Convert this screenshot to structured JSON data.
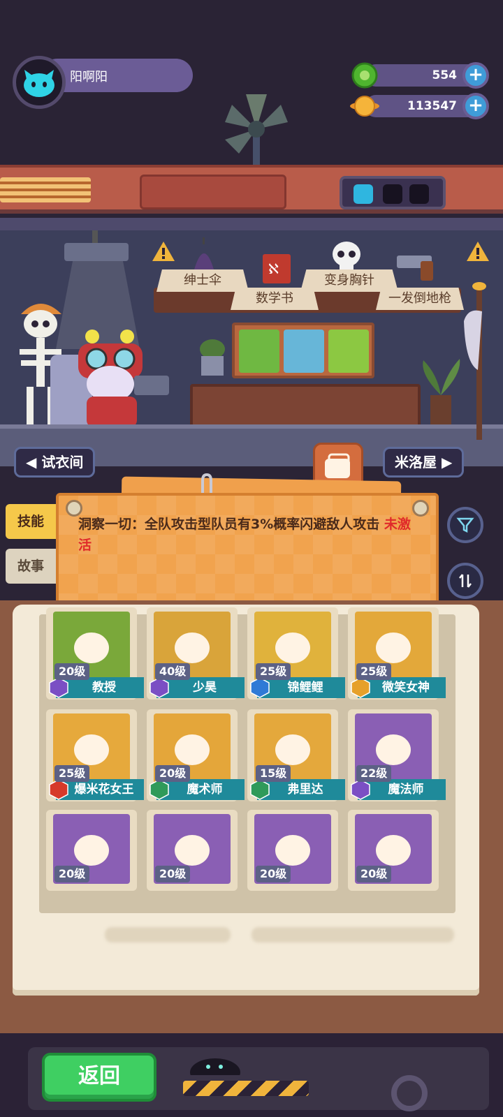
{
  "player": {
    "name": "阳啊阳",
    "avatar_icon": "cat-face-icon"
  },
  "currencies": [
    {
      "name": "gem",
      "value": "554",
      "icon": "green-gem-icon",
      "add_icon": "plus-icon"
    },
    {
      "name": "coin",
      "value": "113547",
      "icon": "orange-planet-coin-icon",
      "add_icon": "plus-icon"
    }
  ],
  "shelf_items": [
    {
      "label": "绅士伞",
      "icon": "umbrella-icon"
    },
    {
      "label": "数学书",
      "icon": "book-icon"
    },
    {
      "label": "变身胸针",
      "icon": "skull-icon"
    },
    {
      "label": "一发倒地枪",
      "icon": "pistol-icon"
    }
  ],
  "nav": {
    "left_label": "试衣间",
    "right_label": "米洛屋",
    "left_icon": "triangle-left-icon",
    "right_icon": "triangle-right-icon"
  },
  "side_tabs": {
    "skill": "技能",
    "story": "故事"
  },
  "skill": {
    "text": "洞察一切：全队攻击型队员有3%概率闪避敌人攻击",
    "status": "未激活",
    "status_color": "#e02a2a"
  },
  "round_buttons": {
    "filter_icon": "filter-icon",
    "sort_icon": "sort-arrows-icon"
  },
  "characters": [
    {
      "name": "教授",
      "level": "20级",
      "rank": "purple",
      "bg": "#7aa83a"
    },
    {
      "name": "少昊",
      "level": "40级",
      "rank": "purple",
      "bg": "#d9a43a"
    },
    {
      "name": "锦鲤鲤",
      "level": "25级",
      "rank": "blue",
      "bg": "#e0b23c"
    },
    {
      "name": "微笑女神",
      "level": "25级",
      "rank": "orange",
      "bg": "#e3a83a"
    },
    {
      "name": "爆米花女王",
      "level": "25级",
      "rank": "red",
      "bg": "#e6a93c"
    },
    {
      "name": "魔术师",
      "level": "20级",
      "rank": "green",
      "bg": "#e4a63a"
    },
    {
      "name": "弗里达",
      "level": "15级",
      "rank": "green",
      "bg": "#e4a83c"
    },
    {
      "name": "魔法师",
      "level": "22级",
      "rank": "purple",
      "bg": "#8a5fb4"
    },
    {
      "name": "",
      "level": "20级",
      "rank": "orange",
      "bg": "#8a5fb4"
    },
    {
      "name": "",
      "level": "20级",
      "rank": "orange",
      "bg": "#8a5fb4"
    },
    {
      "name": "",
      "level": "20级",
      "rank": "orange",
      "bg": "#8a5fb4"
    },
    {
      "name": "",
      "level": "20级",
      "rank": "orange",
      "bg": "#8a5fb4"
    }
  ],
  "rank_colors": {
    "purple": "#7b4fc4",
    "blue": "#2f7ad6",
    "orange": "#e6a02a",
    "red": "#d63a2a",
    "green": "#2f9a5a"
  },
  "back_button": "返回"
}
